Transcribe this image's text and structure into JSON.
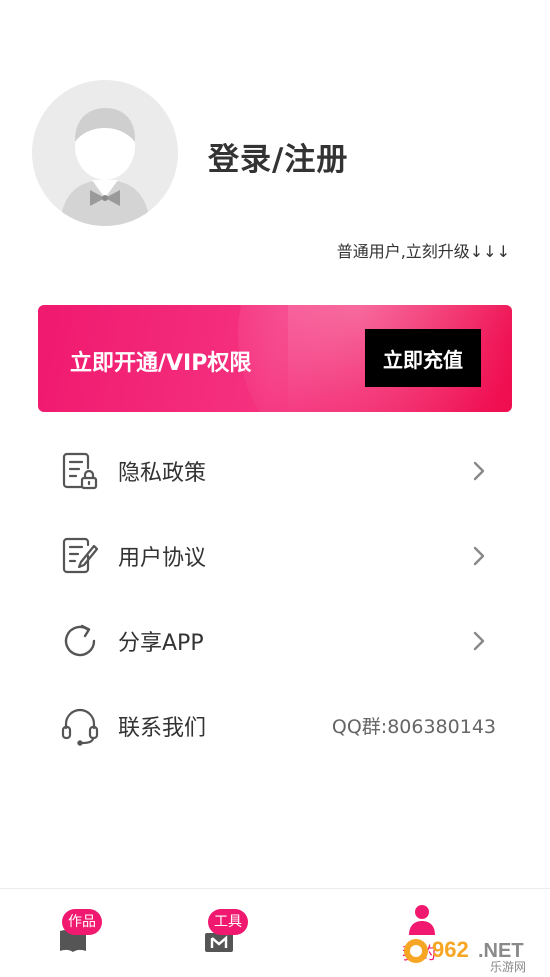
{
  "profile": {
    "login_label": "登录/注册",
    "user_level_text": "普通用户,立刻升级↓↓↓"
  },
  "vip": {
    "text": "立即开通/VIP权限",
    "button_label": "立即充值"
  },
  "menu": {
    "items": [
      {
        "label": "隐私政策",
        "icon": "privacy-doc-lock-icon"
      },
      {
        "label": "用户协议",
        "icon": "agreement-doc-pen-icon"
      },
      {
        "label": "分享APP",
        "icon": "share-refresh-icon"
      },
      {
        "label": "联系我们",
        "icon": "headset-icon",
        "extra": "QQ群:806380143"
      }
    ]
  },
  "tabbar": {
    "tabs": [
      {
        "badge": "作品",
        "icon": "book-icon"
      },
      {
        "badge": "工具",
        "icon": "toolbox-icon"
      },
      {
        "label": "我的",
        "icon": "user-icon"
      }
    ]
  },
  "colors": {
    "accent": "#f0196f",
    "button_bg": "#000000"
  },
  "watermark": {
    "brand": "962.NET",
    "subtitle": "乐游网"
  }
}
